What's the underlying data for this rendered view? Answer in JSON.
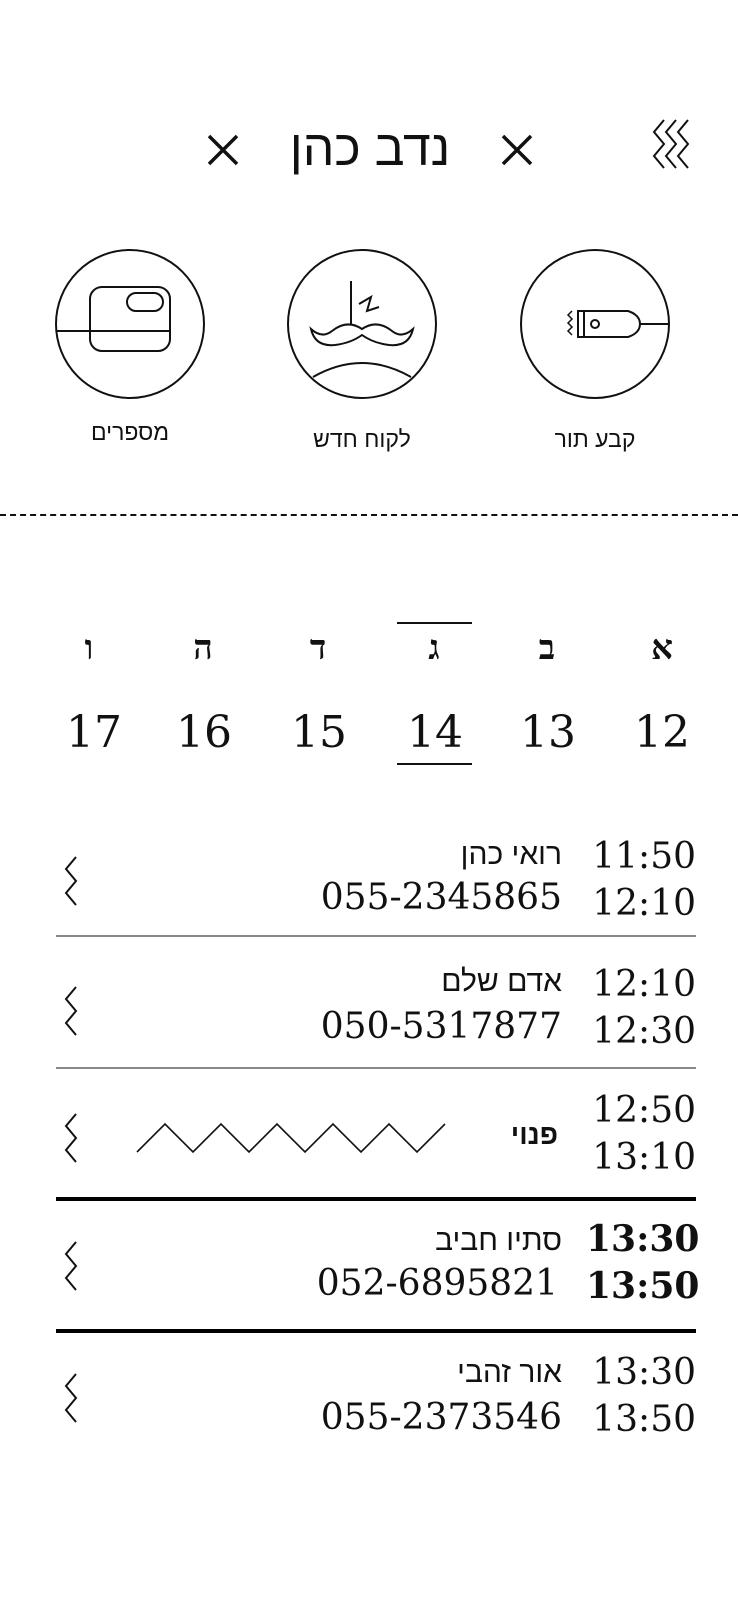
{
  "header": {
    "title": "נדב כהן"
  },
  "actions": [
    {
      "label": "קבע תור",
      "icon": "clipper-icon"
    },
    {
      "label": "לקוח חדש",
      "icon": "mustache-icon"
    },
    {
      "label": "מספרים",
      "icon": "phone-card-icon"
    }
  ],
  "week": {
    "letters": [
      "א",
      "ב",
      "ג",
      "ד",
      "ה",
      "ו"
    ],
    "days": [
      "12",
      "13",
      "14",
      "15",
      "16",
      "17"
    ],
    "selected_index": 2
  },
  "appointments": [
    {
      "start": "11:50",
      "end": "12:10",
      "name": "רואי כהן",
      "phone": "055-2345865",
      "highlight": false,
      "free": false
    },
    {
      "start": "12:10",
      "end": "12:30",
      "name": "אדם שלם",
      "phone": "050-5317877",
      "highlight": false,
      "free": false
    },
    {
      "start": "12:50",
      "end": "13:10",
      "label": "פנוי",
      "free": true
    },
    {
      "start": "13:30",
      "end": "13:50",
      "name": "סתיו חביב",
      "phone": "052-6895821",
      "highlight": true,
      "free": false
    },
    {
      "start": "13:30",
      "end": "13:50",
      "name": "אור זהבי",
      "phone": "055-2373546",
      "highlight": false,
      "free": false
    }
  ],
  "colors": {
    "ink": "#111111",
    "separator": "#888888",
    "background": "#ffffff"
  }
}
